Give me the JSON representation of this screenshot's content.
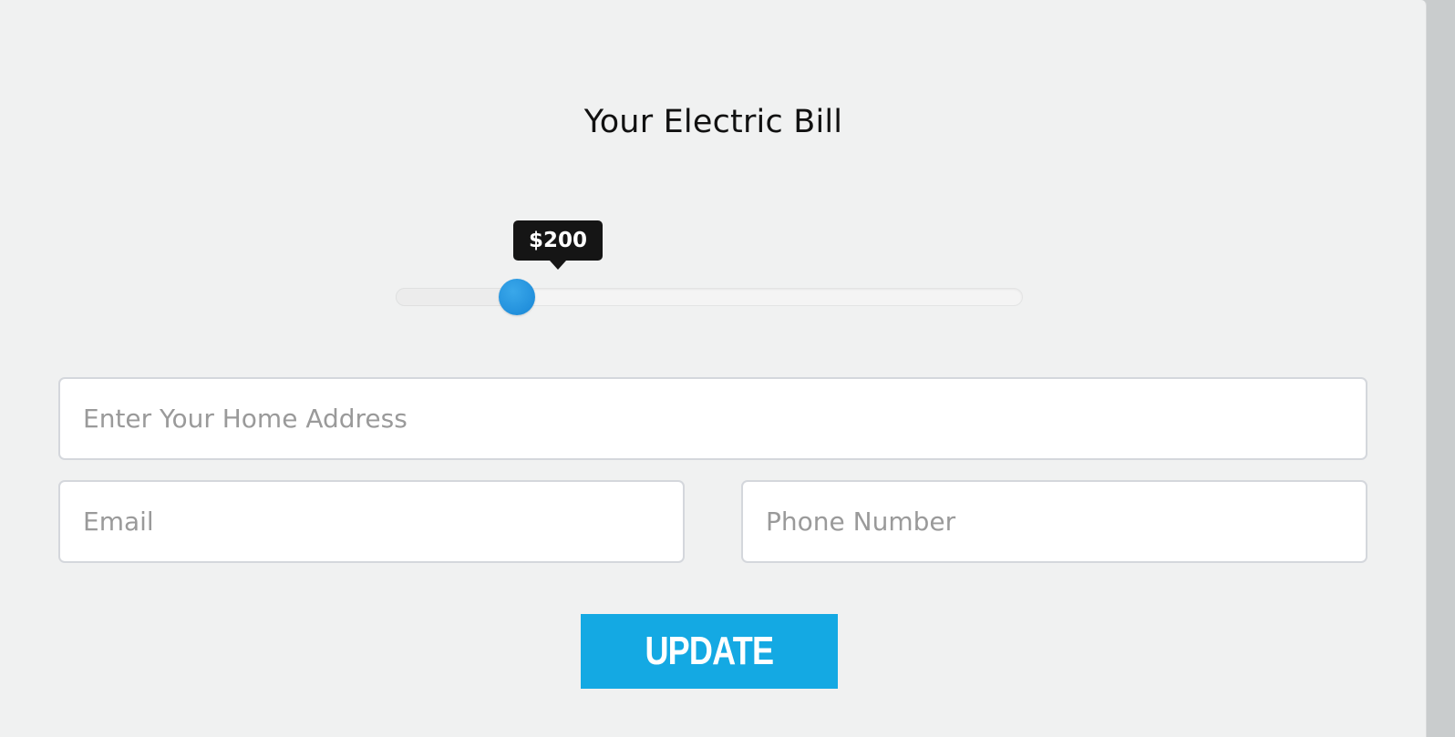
{
  "form": {
    "title": "Your Electric Bill",
    "bill_slider": {
      "value_label": "$200",
      "fraction": 0.194
    },
    "address_field": {
      "placeholder": "Enter Your Home Address",
      "value": ""
    },
    "email_field": {
      "placeholder": "Email",
      "value": ""
    },
    "phone_field": {
      "placeholder": "Phone Number",
      "value": ""
    },
    "submit_label": "UPDATE"
  },
  "colors": {
    "accent": "#14a9e3",
    "thumb": "#2290dc",
    "tooltip_bg": "#151515",
    "background": "#f0f1f1"
  }
}
